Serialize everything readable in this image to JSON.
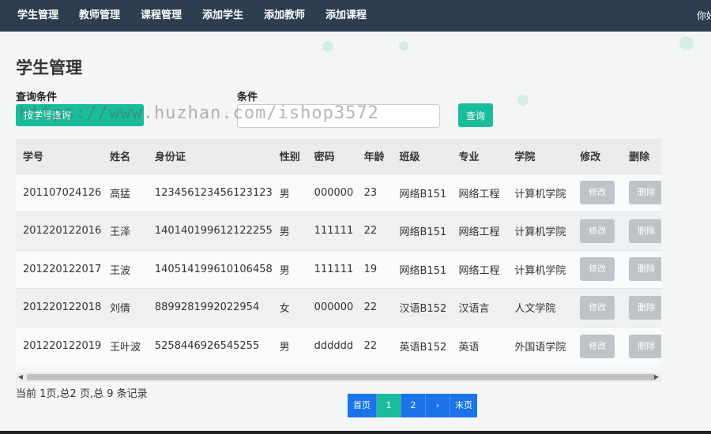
{
  "nav": {
    "items": [
      {
        "label": "学生管理"
      },
      {
        "label": "教师管理"
      },
      {
        "label": "课程管理"
      },
      {
        "label": "添加学生"
      },
      {
        "label": "添加教师"
      },
      {
        "label": "添加课程"
      }
    ],
    "greeting": "你好"
  },
  "page": {
    "title": "学生管理"
  },
  "search": {
    "condition_label": "查询条件",
    "condition_value": "按学号查询",
    "field_label": "条件",
    "placeholder": "",
    "query_label": "查询"
  },
  "watermark": "https://www.huzhan.com/ishop3572",
  "table": {
    "headers": [
      "学号",
      "姓名",
      "身份证",
      "性别",
      "密码",
      "年龄",
      "班级",
      "专业",
      "学院",
      "修改",
      "删除"
    ],
    "rows": [
      [
        "201107024126",
        "高猛",
        "123456123456123123",
        "男",
        "000000",
        "23",
        "网络B151",
        "网络工程",
        "计算机学院"
      ],
      [
        "201220122016",
        "王泽",
        "140140199612122255",
        "男",
        "111111",
        "22",
        "网络B151",
        "网络工程",
        "计算机学院"
      ],
      [
        "201220122017",
        "王波",
        "140514199610106458",
        "男",
        "111111",
        "19",
        "网络B151",
        "网络工程",
        "计算机学院"
      ],
      [
        "201220122018",
        "刘倩",
        "8899281992022954",
        "女",
        "000000",
        "22",
        "汉语B152",
        "汉语言",
        "人文学院"
      ],
      [
        "201220122019",
        "王叶波",
        "5258446926545255",
        "男",
        "dddddd",
        "22",
        "英语B152",
        "英语",
        "外国语学院"
      ]
    ],
    "edit_label": "修改",
    "delete_label": "删除"
  },
  "footer": {
    "record_info": "当前 1页,总2 页,总 9 条记录"
  },
  "pagination": {
    "first": "首页",
    "pages": [
      "1",
      "2"
    ],
    "next": "›",
    "last": "末页",
    "current": "1"
  },
  "colors": {
    "nav_bg": "#2c3e50",
    "accent": "#1abc9c",
    "pager_blue": "#1a73e8",
    "disabled_btn": "#bdc3c7"
  }
}
